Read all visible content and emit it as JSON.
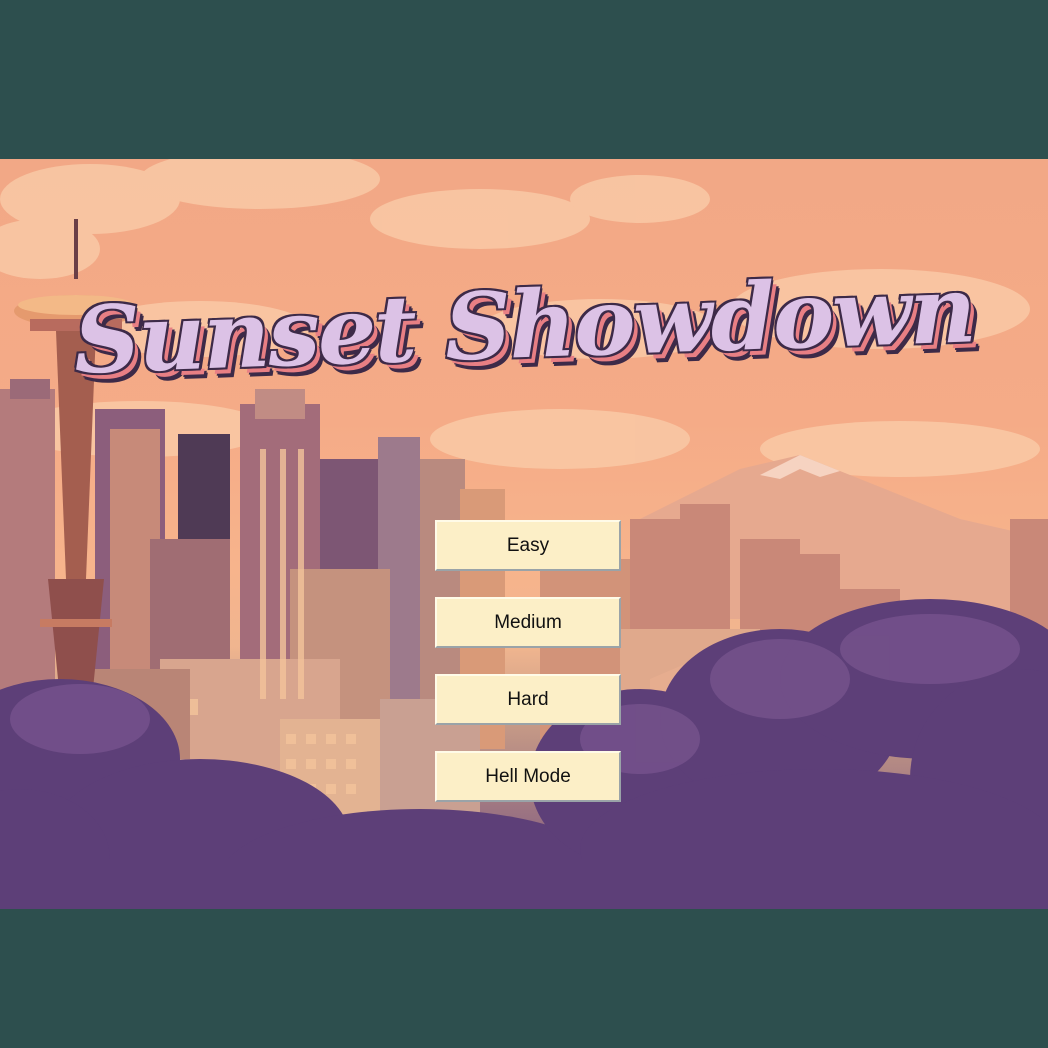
{
  "game": {
    "title": "Sunset Showdown"
  },
  "menu": {
    "buttons": [
      {
        "label": "Easy"
      },
      {
        "label": "Medium"
      },
      {
        "label": "Hard"
      },
      {
        "label": "Hell Mode"
      }
    ]
  },
  "colors": {
    "letterbox": "#2d4f4e",
    "sky": "#f5ab87",
    "title_fill": "#dcc2e6",
    "title_shadow": "#e87f84",
    "button_bg": "#fcefc7",
    "foliage": "#5d3f78"
  }
}
